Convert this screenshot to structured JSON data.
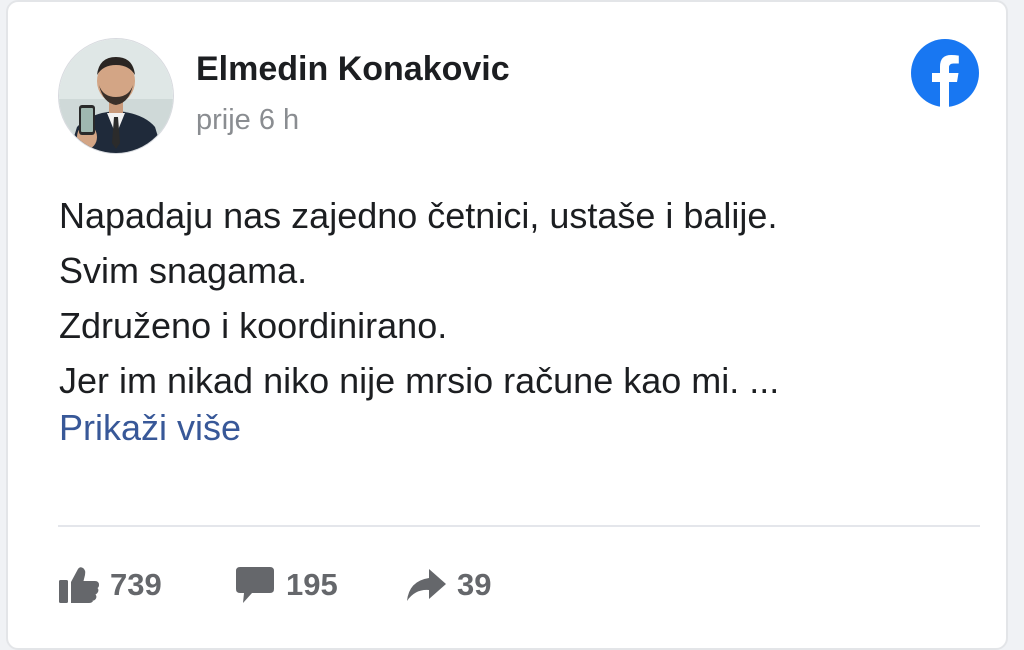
{
  "post": {
    "author": "Elmedin Konakovic",
    "time": "prije 6 h",
    "lines": [
      "Napadaju nas zajedno četnici, ustaše i balije.",
      "Svim snagama.",
      "Združeno i koordinirano.",
      "Jer im nikad niko nije mrsio račune kao mi. ..."
    ],
    "see_more": "Prikaži više"
  },
  "stats": {
    "likes": "739",
    "comments": "195",
    "shares": "39"
  },
  "icons": {
    "brand": "facebook-logo-icon",
    "like": "thumbs-up-icon",
    "comment": "speech-bubble-icon",
    "share": "share-arrow-icon"
  },
  "colors": {
    "facebook_blue": "#1877f2",
    "link": "#385898",
    "icon_gray": "#65676b"
  }
}
